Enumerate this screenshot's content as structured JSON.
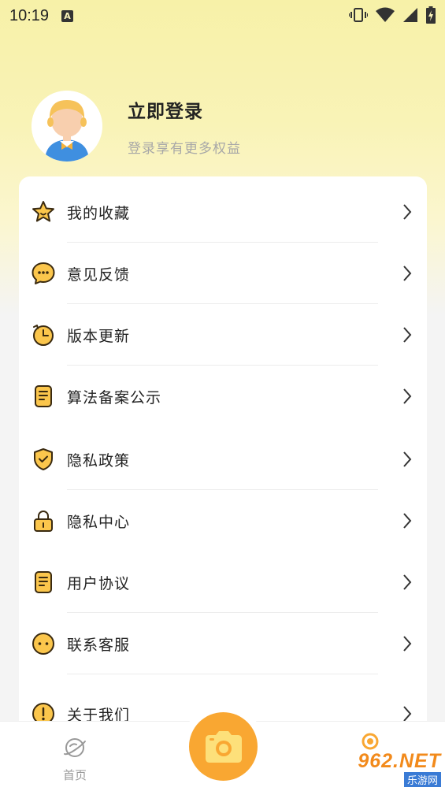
{
  "status_bar": {
    "time": "10:19",
    "notification_icon": "A"
  },
  "profile": {
    "title": "立即登录",
    "subtitle": "登录享有更多权益"
  },
  "menu": [
    {
      "label": "我的收藏",
      "icon": "star-icon"
    },
    {
      "label": "意见反馈",
      "icon": "chat-bubble-icon"
    },
    {
      "label": "版本更新",
      "icon": "clock-refresh-icon"
    },
    {
      "label": "算法备案公示",
      "icon": "document-icon"
    },
    {
      "label": "隐私政策",
      "icon": "shield-check-icon"
    },
    {
      "label": "隐私中心",
      "icon": "lock-icon"
    },
    {
      "label": "用户协议",
      "icon": "document-icon"
    },
    {
      "label": "联系客服",
      "icon": "face-icon"
    },
    {
      "label": "关于我们",
      "icon": "info-icon"
    }
  ],
  "bottom_nav": {
    "home_label": "首页"
  },
  "watermark": {
    "top": "962.NET",
    "bottom": "乐游网"
  },
  "colors": {
    "accent": "#f9a732",
    "icon_fill": "#fbc64c",
    "icon_stroke": "#3a2a10"
  }
}
